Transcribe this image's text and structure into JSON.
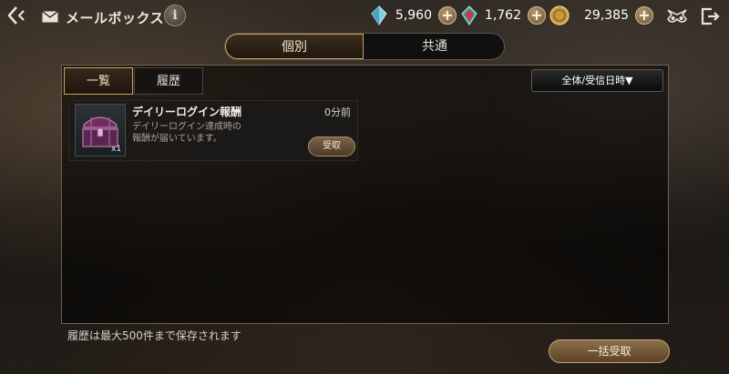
{
  "header": {
    "title": "メールボックス",
    "info_label": "i",
    "currencies": [
      {
        "icon": "blue-crystal-icon",
        "value": "5,960",
        "plus": "+"
      },
      {
        "icon": "red-crystal-icon",
        "value": "1,762",
        "plus": "+"
      },
      {
        "icon": "gold-coin-icon",
        "value": "29,385",
        "plus": "+"
      }
    ]
  },
  "tabs": {
    "individual": "個別",
    "common": "共通"
  },
  "subtabs": {
    "list": "一覧",
    "history": "履歴"
  },
  "sort": {
    "label": "全体/受信日時▼"
  },
  "mail_items": [
    {
      "title": "デイリーログイン報酬",
      "time": "0分前",
      "description_line1": "デイリーログイン達成時の",
      "description_line2": "報酬が届いています。",
      "quantity": "x1",
      "claim_label": "受取",
      "icon": "treasure-chest-icon"
    }
  ],
  "footer": {
    "note": "履歴は最大500件まで保存されます",
    "bulk_claim_label": "一括受取"
  },
  "colors": {
    "accent_gold": "#d1a363",
    "panel_border": "#6e6152"
  }
}
